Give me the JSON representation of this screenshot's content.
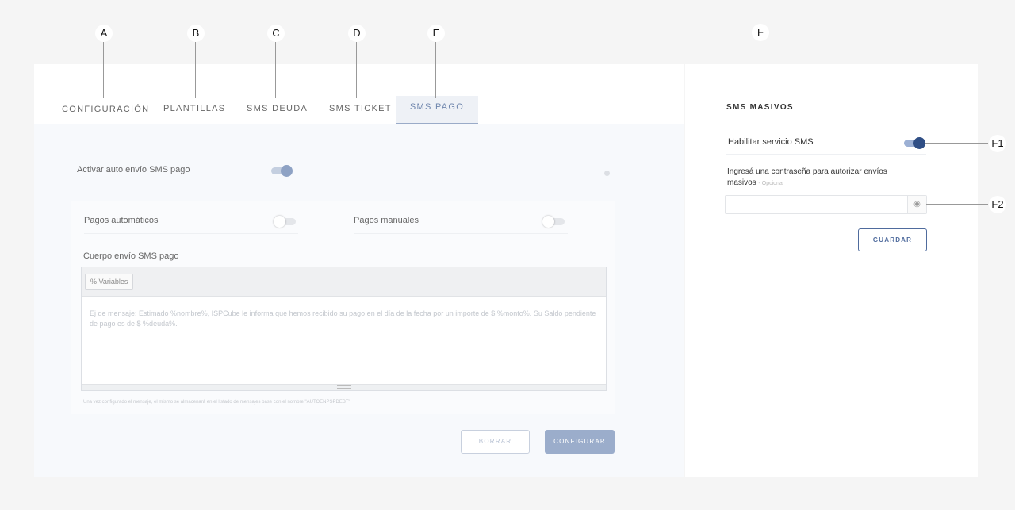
{
  "callouts": {
    "a": "A",
    "b": "B",
    "c": "C",
    "d": "D",
    "e": "E",
    "f": "F",
    "f1": "F1",
    "f2": "F2"
  },
  "tabs": [
    {
      "label": "CONFIGURACIÓN"
    },
    {
      "label": "PLANTILLAS"
    },
    {
      "label": "SMS DEUDA"
    },
    {
      "label": "SMS TICKET"
    },
    {
      "label": "SMS PAGO",
      "active": true
    }
  ],
  "sms_pago": {
    "auto_send_label": "Activar auto envío SMS pago",
    "auto_send_enabled": true,
    "auto_payments_label": "Pagos automáticos",
    "auto_payments_enabled": false,
    "manual_payments_label": "Pagos manuales",
    "manual_payments_enabled": false,
    "body_label": "Cuerpo envío SMS pago",
    "variables_button": "%  Variables",
    "editor_placeholder": "Ej de mensaje: Estimado %nombre%, ISPCube le informa que hemos recibido su pago en el día de la fecha por un importe de $ %monto%. Su Saldo pendiente de pago es de $ %deuda%.",
    "hint": "Una vez configurado el mensaje, el mismo se almacenará en el listado de mensajes base con el nombre \"AUTOENPSPDEBT\"",
    "clear_button": "BORRAR",
    "configure_button": "CONFIGURAR"
  },
  "sms_masivos": {
    "title": "SMS MASIVOS",
    "enable_label": "Habilitar servicio SMS",
    "enable_on": true,
    "password_label": "Ingresá una contraseña para autorizar envíos masivos",
    "password_optional": "- Opcional",
    "password_value": "",
    "eye_icon": "eye-icon",
    "save_button": "GUARDAR"
  },
  "colors": {
    "accent": "#2f4e85",
    "accent_muted": "#9badcb",
    "background": "#f5f5f5"
  }
}
